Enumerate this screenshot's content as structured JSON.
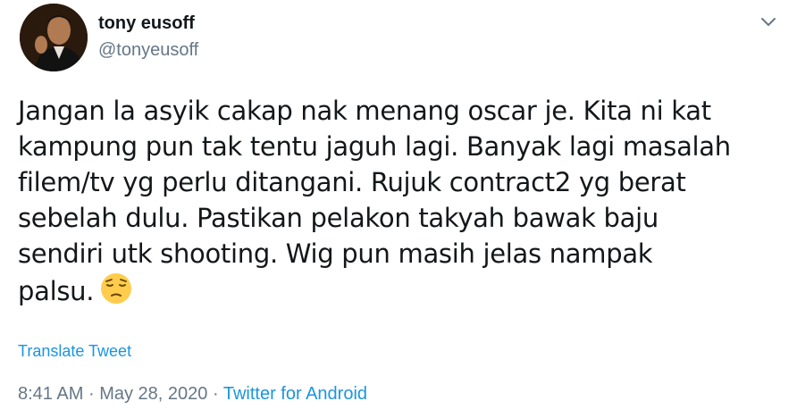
{
  "user": {
    "display_name": "tony eusoff",
    "handle": "@tonyeusoff"
  },
  "tweet": {
    "text": "Jangan la asyik cakap nak menang oscar je. Kita ni kat\nkampung pun tak tentu jaguh lagi. Banyak lagi masalah\nfilem/tv yg perlu ditangani. Rujuk contract2 yg berat\nsebelah dulu. Pastikan pelakon takyah bawak baju\nsendiri utk shooting. Wig pun masih jelas nampak\npalsu.",
    "emoji": "pensive-face-icon"
  },
  "translate_label": "Translate Tweet",
  "meta": {
    "time": "8:41 AM",
    "separator": "·",
    "date": "May 28, 2020",
    "source": "Twitter for Android"
  },
  "colors": {
    "text": "#14171a",
    "secondary": "#657786",
    "link": "#1b95e0"
  },
  "icons": {
    "menu": "chevron-down-icon"
  }
}
